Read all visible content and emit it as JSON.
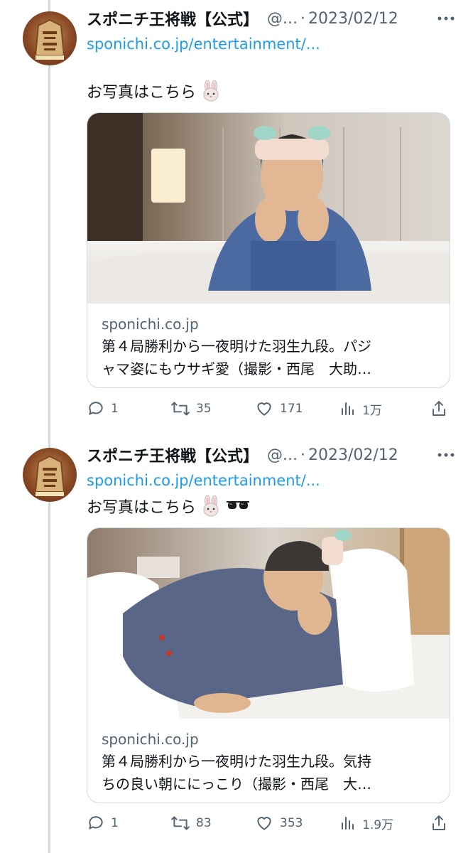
{
  "tweets": [
    {
      "author_name": "スポニチ王将戦【公式】",
      "handle": "@...",
      "separator": "·",
      "date": "2023/02/12",
      "link": "sponichi.co.jp/entertainment/...",
      "text": "お写真はこちら",
      "emojis": [
        "rabbit-face-emoji"
      ],
      "card": {
        "domain": "sponichi.co.jp",
        "title_line1": "第４局勝利から一夜明けた羽生九段。パジ",
        "title_line2": "ャマ姿にもウサギ愛（撮影・西尾　大助…"
      },
      "actions": {
        "replies": "1",
        "retweets": "35",
        "likes": "171",
        "views": "1万"
      }
    },
    {
      "author_name": "スポニチ王将戦【公式】",
      "handle": "@...",
      "separator": "·",
      "date": "2023/02/12",
      "link": "sponichi.co.jp/entertainment/...",
      "text": "お写真はこちら",
      "emojis": [
        "rabbit-face-emoji",
        "sunglasses-emoji"
      ],
      "card": {
        "domain": "sponichi.co.jp",
        "title_line1": "第４局勝利から一夜明けた羽生九段。気持",
        "title_line2": "ちの良い朝ににっこり（撮影・西尾　大…"
      },
      "actions": {
        "replies": "1",
        "retweets": "83",
        "likes": "353",
        "views": "1.9万"
      }
    }
  ],
  "colors": {
    "link": "#1d9bf0",
    "muted": "#536471",
    "border": "#cfd9de"
  }
}
